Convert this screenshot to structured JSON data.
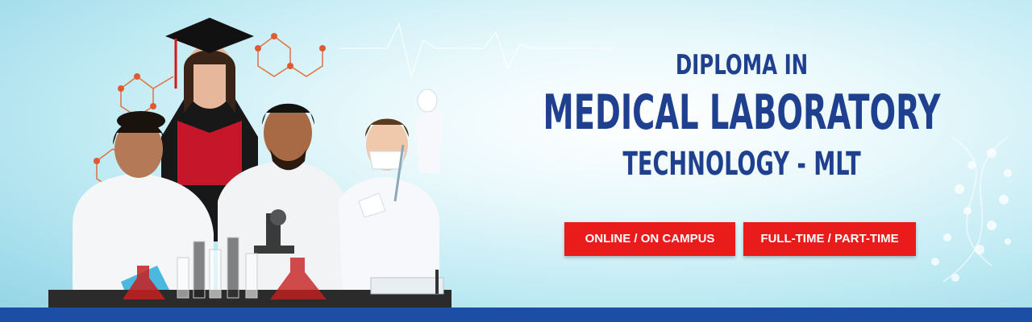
{
  "headline": {
    "line1": "DIPLOMA IN",
    "line2": "MEDICAL LABORATORY",
    "line3": "TECHNOLOGY - MLT"
  },
  "badges": [
    {
      "label": "ONLINE / ON CAMPUS"
    },
    {
      "label": "FULL-TIME / PART-TIME"
    }
  ],
  "colors": {
    "headline": "#1f3f8f",
    "badge": "#ea1b1b",
    "bottom_bar": "#1c4ea6"
  }
}
